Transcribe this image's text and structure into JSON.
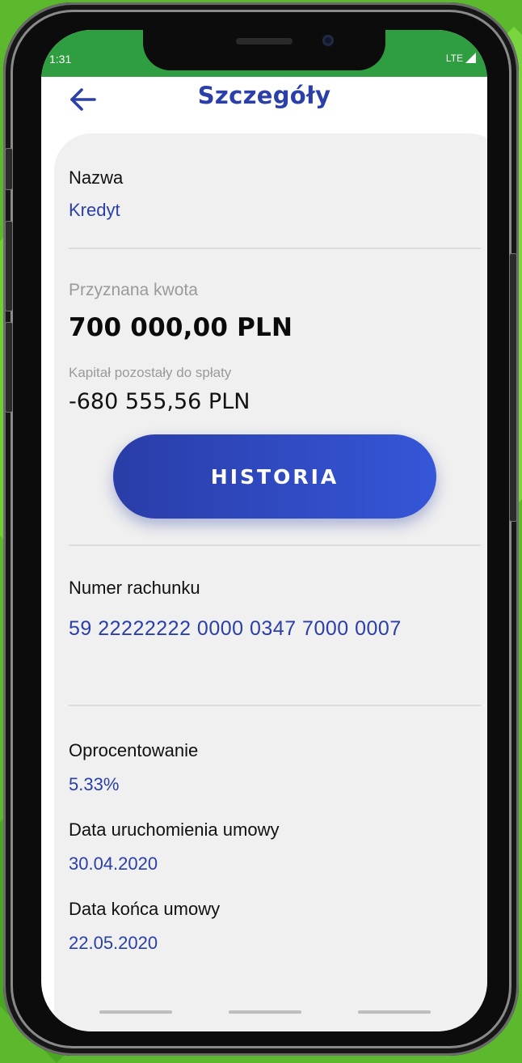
{
  "status_bar": {
    "time": "1:31",
    "network": "LTE"
  },
  "header": {
    "title": "Szczegóły",
    "back_icon": "arrow-left-icon"
  },
  "details": {
    "name_label": "Nazwa",
    "name_value": "Kredyt",
    "granted_amount_label": "Przyznana kwota",
    "granted_amount_value": "700 000,00 PLN",
    "remaining_capital_label": "Kapitał pozostały do spłaty",
    "remaining_capital_value": "-680 555,56 PLN",
    "history_button_label": "HISTORIA",
    "account_number_label": "Numer rachunku",
    "account_number_value": "59 22222222 0000 0347 7000 0007",
    "interest_label": "Oprocentowanie",
    "interest_value": "5.33%",
    "start_date_label": "Data uruchomienia umowy",
    "start_date_value": "30.04.2020",
    "end_date_label": "Data końca umowy",
    "end_date_value": "22.05.2020"
  },
  "colors": {
    "background": "#5cb82c",
    "status_bar": "#2f9e41",
    "accent_blue": "#2a3fa8",
    "card": "#f0f0f0"
  }
}
